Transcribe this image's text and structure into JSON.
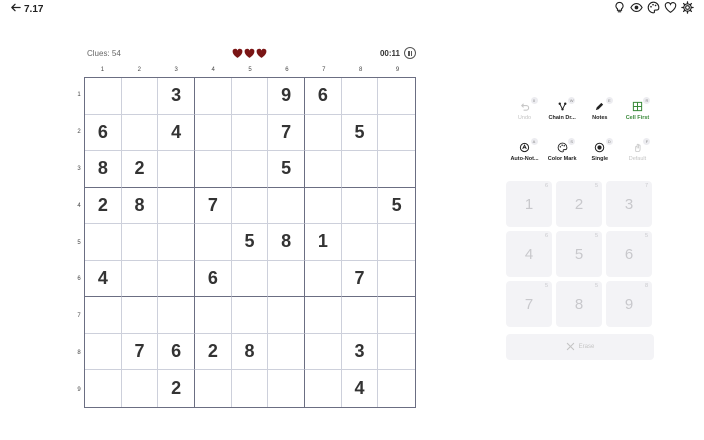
{
  "header": {
    "back_label": "7.17",
    "icons": [
      "lightbulb-icon",
      "eye-icon",
      "palette-icon",
      "heart-icon",
      "gear-icon"
    ]
  },
  "game": {
    "clues_label": "Clues: 54",
    "lives": 3,
    "timer": "00:11"
  },
  "colors": {
    "heart": "#7a1515",
    "active_tool": "#3a8a3a",
    "grid_major": "#6b6e82",
    "grid_minor": "#cdd0db"
  },
  "board": {
    "col_labels": [
      "1",
      "2",
      "3",
      "4",
      "5",
      "6",
      "7",
      "8",
      "9"
    ],
    "row_labels": [
      "1",
      "2",
      "3",
      "4",
      "5",
      "6",
      "7",
      "8",
      "9"
    ],
    "cells": [
      [
        "",
        "",
        "3",
        "",
        "",
        "9",
        "6",
        "",
        ""
      ],
      [
        "6",
        "",
        "4",
        "",
        "",
        "7",
        "",
        "5",
        ""
      ],
      [
        "8",
        "2",
        "",
        "",
        "",
        "5",
        "",
        "",
        ""
      ],
      [
        "2",
        "8",
        "",
        "7",
        "",
        "",
        "",
        "",
        "5"
      ],
      [
        "",
        "",
        "",
        "",
        "5",
        "8",
        "1",
        "",
        ""
      ],
      [
        "4",
        "",
        "",
        "6",
        "",
        "",
        "",
        "7",
        ""
      ],
      [
        "",
        "",
        "",
        "",
        "",
        "",
        "",
        "",
        ""
      ],
      [
        "",
        "7",
        "6",
        "2",
        "8",
        "",
        "",
        "3",
        ""
      ],
      [
        "",
        "",
        "2",
        "",
        "",
        "",
        "",
        "4",
        ""
      ]
    ]
  },
  "tools": [
    {
      "label": "Undo",
      "badge": "0",
      "icon": "undo-icon",
      "state": "disabled"
    },
    {
      "label": "Chain Dr...",
      "badge": "W",
      "icon": "chain-draw-icon",
      "state": "normal"
    },
    {
      "label": "Notes",
      "badge": "E",
      "icon": "pencil-icon",
      "state": "normal"
    },
    {
      "label": "Cell First",
      "badge": "R",
      "icon": "grid-icon",
      "state": "active"
    },
    {
      "label": "Auto-Not...",
      "badge": "A",
      "icon": "auto-notes-icon",
      "state": "normal"
    },
    {
      "label": "Color Mark",
      "badge": "S",
      "icon": "palette-icon",
      "state": "normal"
    },
    {
      "label": "Single",
      "badge": "D",
      "icon": "target-icon",
      "state": "normal"
    },
    {
      "label": "Default",
      "badge": "F",
      "icon": "hand-icon",
      "state": "disabled"
    }
  ],
  "keypad": [
    {
      "num": "1",
      "count": "6"
    },
    {
      "num": "2",
      "count": "5"
    },
    {
      "num": "3",
      "count": "7"
    },
    {
      "num": "4",
      "count": "6"
    },
    {
      "num": "5",
      "count": "5"
    },
    {
      "num": "6",
      "count": "5"
    },
    {
      "num": "7",
      "count": "5"
    },
    {
      "num": "8",
      "count": "5"
    },
    {
      "num": "9",
      "count": "8"
    }
  ],
  "erase_label": "Erase"
}
